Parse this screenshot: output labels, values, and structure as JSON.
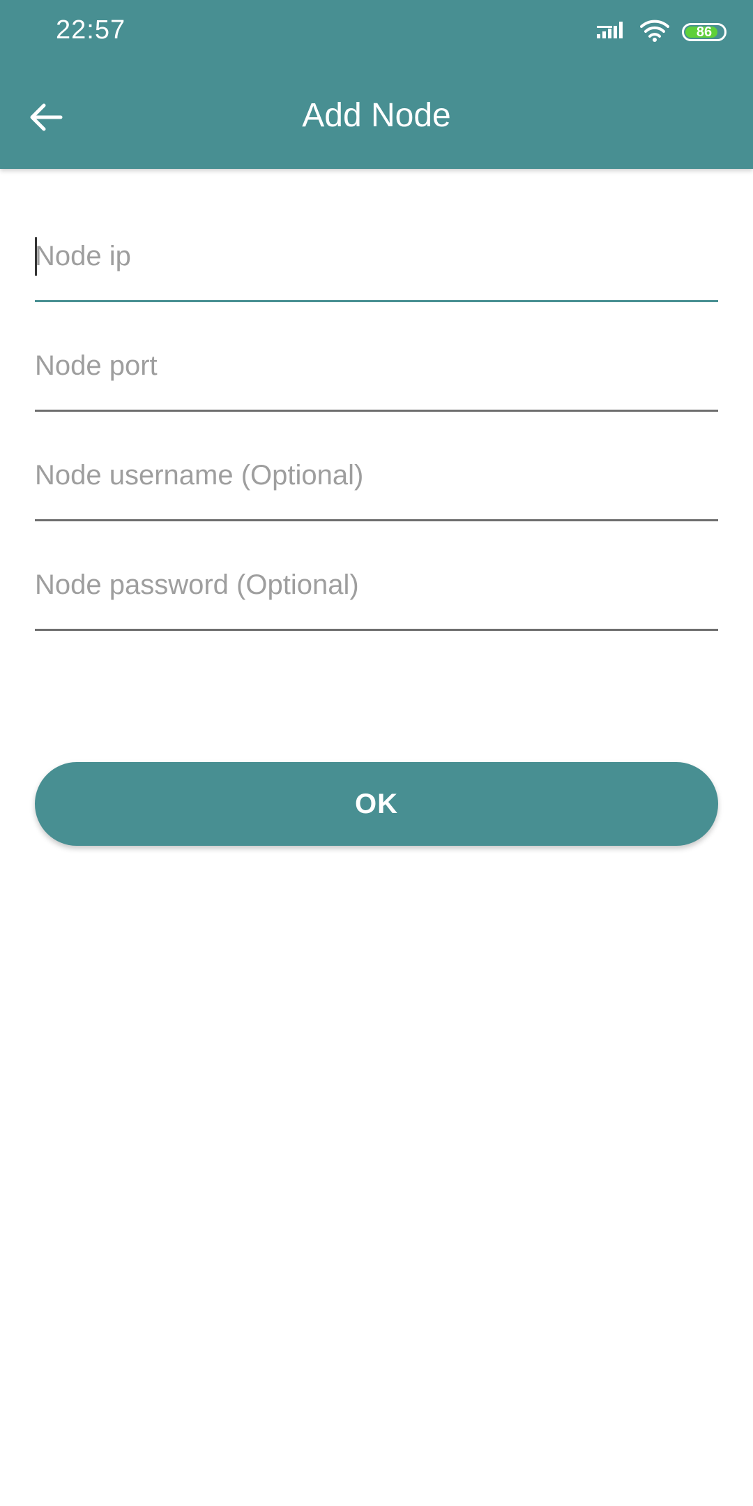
{
  "status_bar": {
    "time": "22:57",
    "battery_level": "86",
    "battery_fraction": 0.86,
    "icons": [
      "signal-icon",
      "wifi-icon",
      "battery-icon"
    ]
  },
  "toolbar": {
    "title": "Add Node",
    "back_icon": "arrow-left-icon"
  },
  "form": {
    "fields": [
      {
        "placeholder": "Node ip",
        "value": ""
      },
      {
        "placeholder": "Node port",
        "value": ""
      },
      {
        "placeholder": "Node username (Optional)",
        "value": ""
      },
      {
        "placeholder": "Node password (Optional)",
        "value": ""
      }
    ]
  },
  "ok_button": {
    "label": "OK"
  },
  "colors": {
    "primary": "#488f92",
    "battery": "#5fd03a"
  }
}
